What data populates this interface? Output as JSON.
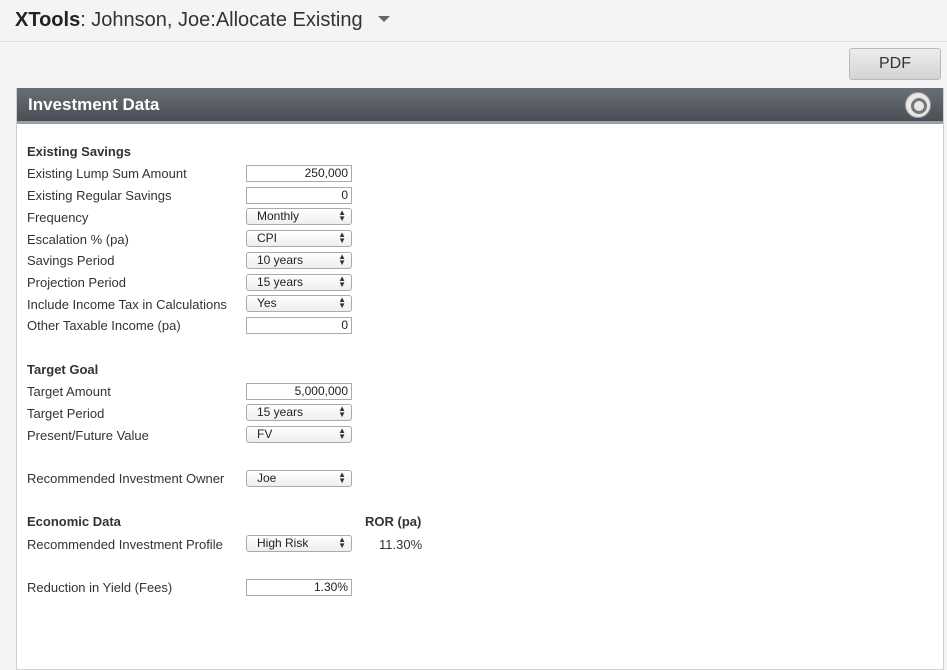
{
  "header": {
    "brand": "XTools",
    "title_rest": ": Johnson, Joe:Allocate Existing"
  },
  "toolbar": {
    "pdf_label": "PDF"
  },
  "panel": {
    "title": "Investment Data"
  },
  "existing_savings": {
    "title": "Existing Savings",
    "lump_sum": {
      "label": "Existing Lump Sum Amount",
      "value": "250,000"
    },
    "regular_savings": {
      "label": "Existing Regular Savings",
      "value": "0"
    },
    "frequency": {
      "label": "Frequency",
      "value": "Monthly"
    },
    "escalation": {
      "label": "Escalation % (pa)",
      "value": "CPI"
    },
    "savings_period": {
      "label": "Savings Period",
      "value": "10 years"
    },
    "projection_period": {
      "label": "Projection Period",
      "value": "15 years"
    },
    "income_tax": {
      "label": "Include Income Tax in Calculations",
      "value": "Yes"
    },
    "other_income": {
      "label": "Other Taxable Income (pa)",
      "value": "0"
    }
  },
  "target_goal": {
    "title": "Target Goal",
    "amount": {
      "label": "Target Amount",
      "value": "5,000,000"
    },
    "period": {
      "label": "Target Period",
      "value": "15 years"
    },
    "value_type": {
      "label": "Present/Future Value",
      "value": "FV"
    }
  },
  "owner": {
    "label": "Recommended Investment Owner",
    "value": "Joe"
  },
  "economic_data": {
    "title": "Economic Data",
    "ror_header": "ROR (pa)",
    "profile": {
      "label": "Recommended Investment Profile",
      "value": "High Risk",
      "ror": "11.30%"
    },
    "fees": {
      "label": "Reduction in Yield (Fees)",
      "value": "1.30%"
    }
  }
}
